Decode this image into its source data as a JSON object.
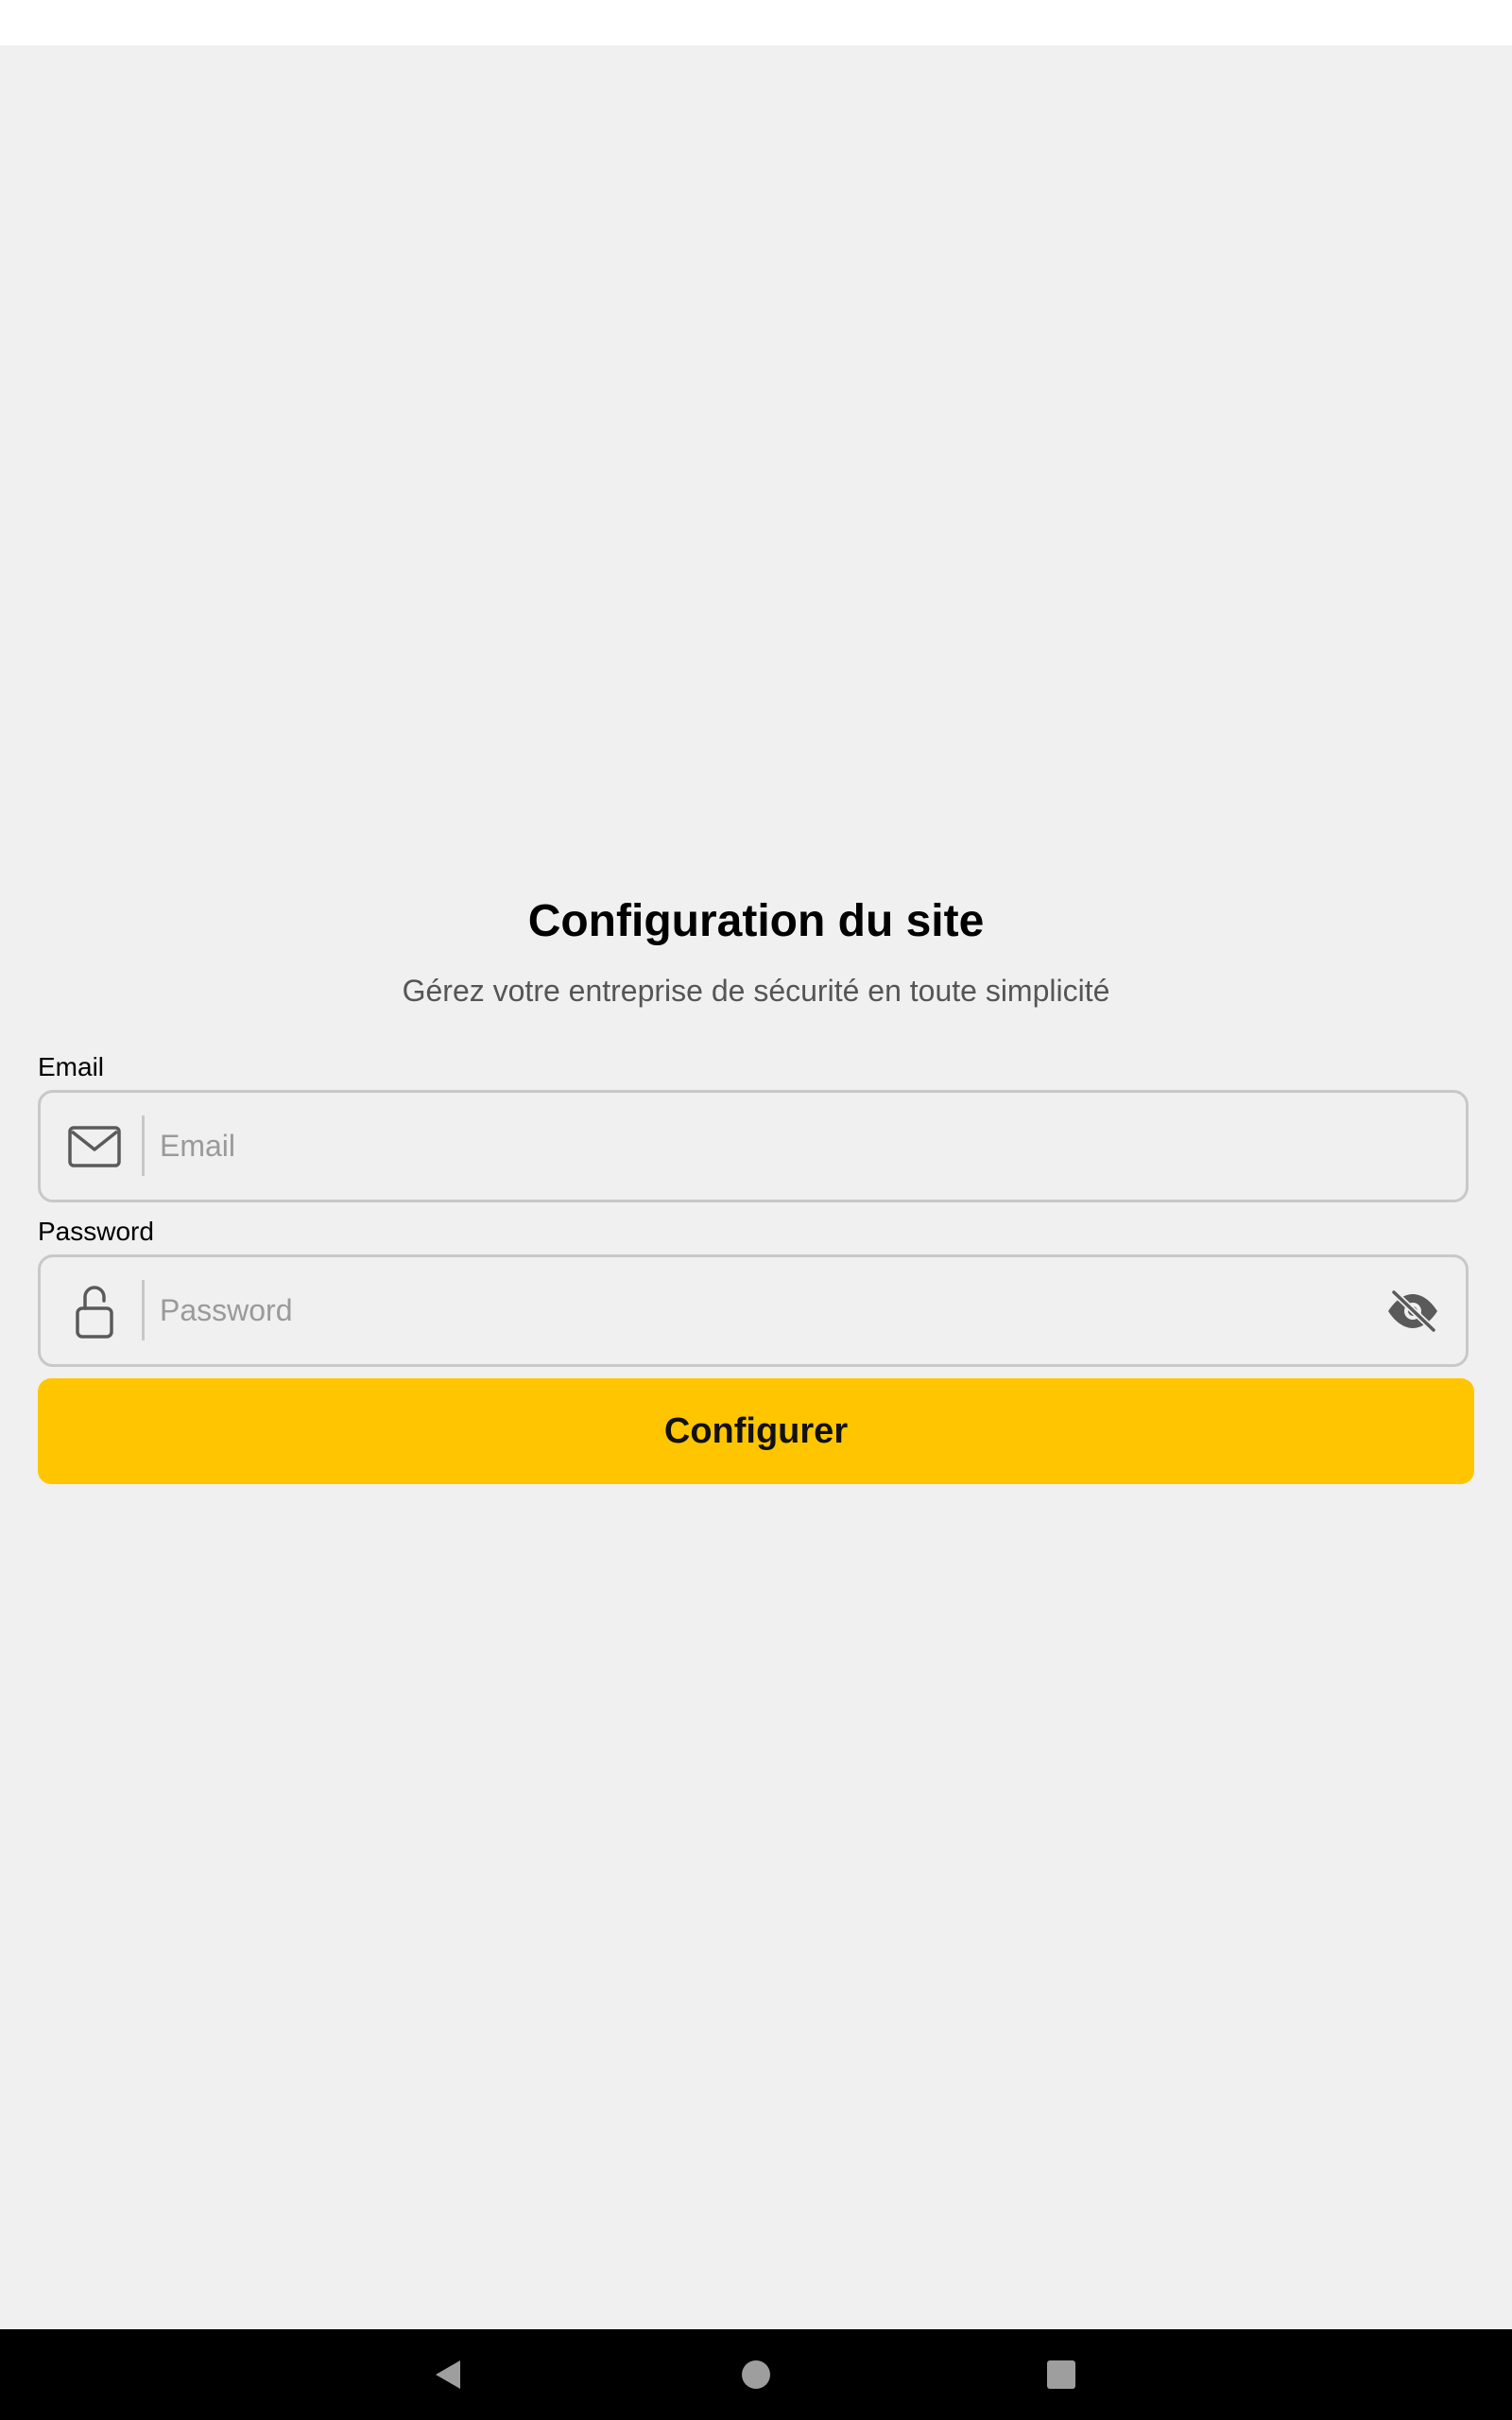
{
  "page": {
    "title": "Configuration du site",
    "subtitle": "Gérez votre entreprise de sécurité en toute simplicité"
  },
  "form": {
    "email": {
      "label": "Email",
      "placeholder": "Email",
      "value": "",
      "icon": "mail-icon"
    },
    "password": {
      "label": "Password",
      "placeholder": "Password",
      "value": "",
      "icon": "unlock-icon",
      "visibility_icon": "eye-off-icon"
    },
    "submit_label": "Configurer"
  },
  "navigation_bar": {
    "buttons": [
      "back-icon",
      "home-icon",
      "recents-icon"
    ]
  },
  "colors": {
    "background": "#f0f0f0",
    "accent": "#ffc600",
    "field_border": "#c8c8c8",
    "navigation_bar": "#000000"
  }
}
